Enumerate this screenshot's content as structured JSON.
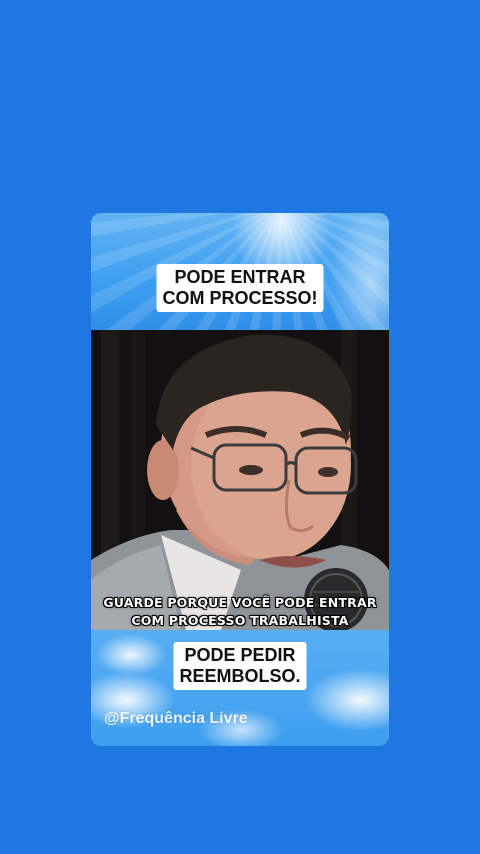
{
  "colors": {
    "background": "#1f77e1",
    "caption_bg": "#ffffff",
    "caption_text": "#111111"
  },
  "top_caption": {
    "line1": "PODE ENTRAR",
    "line2": "COM PROCESSO!"
  },
  "subtitle": {
    "line1": "GUARDE PORQUE VOCÊ PODE ENTRAR",
    "line2": "COM PROCESSO TRABALHISTA"
  },
  "bottom_caption": {
    "line1": "PODE PEDIR",
    "line2": "REEMBOLSO."
  },
  "watermark": "@Frequência Livre"
}
